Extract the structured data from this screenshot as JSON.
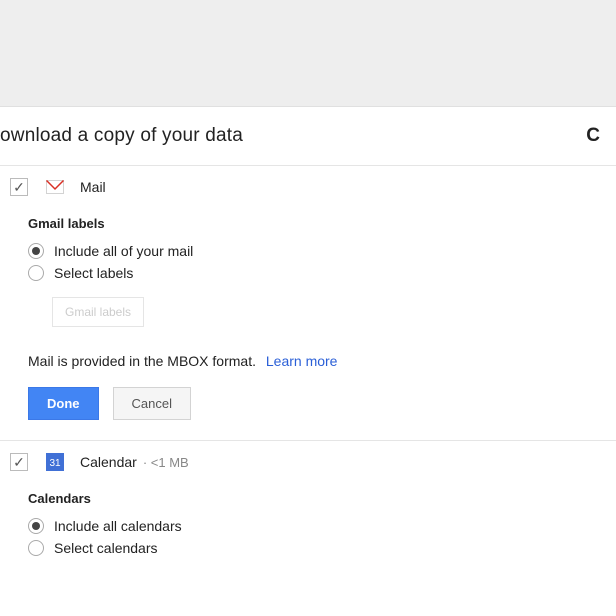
{
  "title": "ownload a copy of your data",
  "right_text": "C",
  "sections": {
    "mail": {
      "name": "Mail",
      "subhead": "Gmail labels",
      "options": {
        "include_all": "Include all of your mail",
        "select_labels": "Select labels"
      },
      "labels_button": "Gmail labels",
      "format_text": "Mail is provided in the MBOX format.",
      "learn_more": "Learn more",
      "done": "Done",
      "cancel": "Cancel"
    },
    "calendar": {
      "name": "Calendar",
      "meta": "· <1 MB",
      "subhead": "Calendars",
      "options": {
        "include_all": "Include all calendars",
        "select_calendars": "Select calendars"
      }
    }
  }
}
